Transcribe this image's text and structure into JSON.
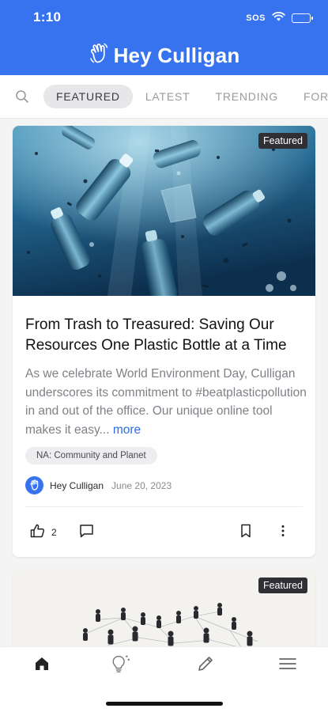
{
  "status_bar": {
    "time": "1:10",
    "sos": "SOS"
  },
  "header": {
    "title": "Hey Culligan",
    "logo_icon": "waving-hand-icon",
    "background": "#3873ef"
  },
  "tabs": [
    {
      "label": "FEATURED",
      "active": true
    },
    {
      "label": "LATEST",
      "active": false
    },
    {
      "label": "TRENDING",
      "active": false
    },
    {
      "label": "FOR YOU",
      "active": false
    }
  ],
  "posts": [
    {
      "badge": "Featured",
      "image": "plastic-bottles-underwater",
      "title": "From Trash to Treasured: Saving Our Resources One Plastic Bottle at a Time",
      "excerpt": "As we celebrate World Environment Day, Culligan underscores its commitment to #beatplasticpollution in and out of the office. Our unique online tool makes it easy...",
      "more_label": " more",
      "tag": "NA: Community and Planet",
      "author": "Hey Culligan",
      "date": "June 20, 2023",
      "likes": "2"
    },
    {
      "badge": "Featured",
      "image": "people-network"
    }
  ],
  "bottom_nav": [
    {
      "icon": "home-icon",
      "active": true
    },
    {
      "icon": "lightbulb-icon",
      "active": false
    },
    {
      "icon": "pencil-icon",
      "active": false
    },
    {
      "icon": "menu-icon",
      "active": false
    }
  ],
  "colors": {
    "accent": "#3873ef",
    "link": "#2f6be0",
    "badge_bg": "#2f2f34"
  }
}
